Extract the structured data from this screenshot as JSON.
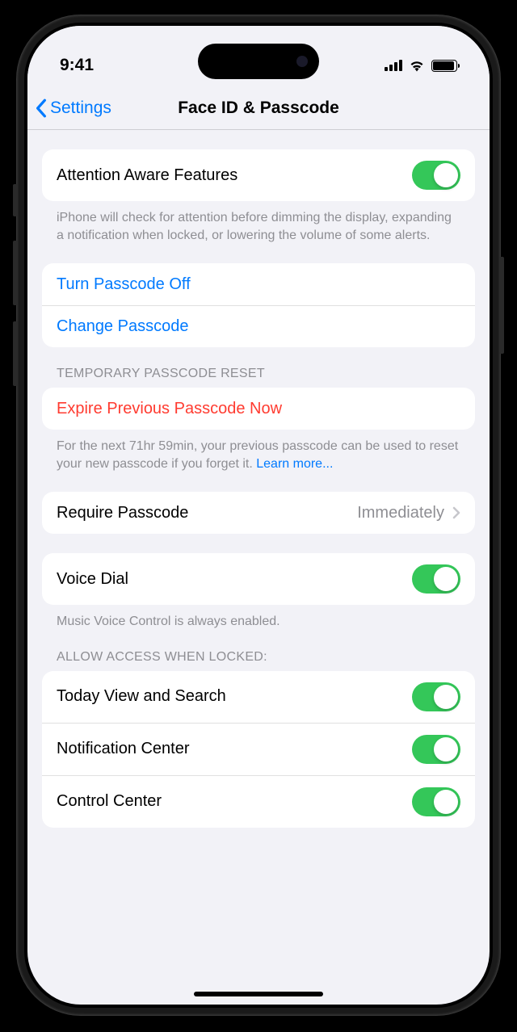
{
  "status": {
    "time": "9:41"
  },
  "nav": {
    "back": "Settings",
    "title": "Face ID & Passcode"
  },
  "attention": {
    "label": "Attention Aware Features",
    "footer": "iPhone will check for attention before dimming the display, expanding a notification when locked, or lowering the volume of some alerts."
  },
  "passcode": {
    "turn_off": "Turn Passcode Off",
    "change": "Change Passcode"
  },
  "temporary": {
    "header": "TEMPORARY PASSCODE RESET",
    "expire": "Expire Previous Passcode Now",
    "footer": "For the next 71hr 59min, your previous passcode can be used to reset your new passcode if you forget it. ",
    "learn_more": "Learn more..."
  },
  "require": {
    "label": "Require Passcode",
    "value": "Immediately"
  },
  "voice": {
    "label": "Voice Dial",
    "footer": "Music Voice Control is always enabled."
  },
  "allow": {
    "header": "ALLOW ACCESS WHEN LOCKED:",
    "today": "Today View and Search",
    "notification": "Notification Center",
    "control": "Control Center"
  }
}
